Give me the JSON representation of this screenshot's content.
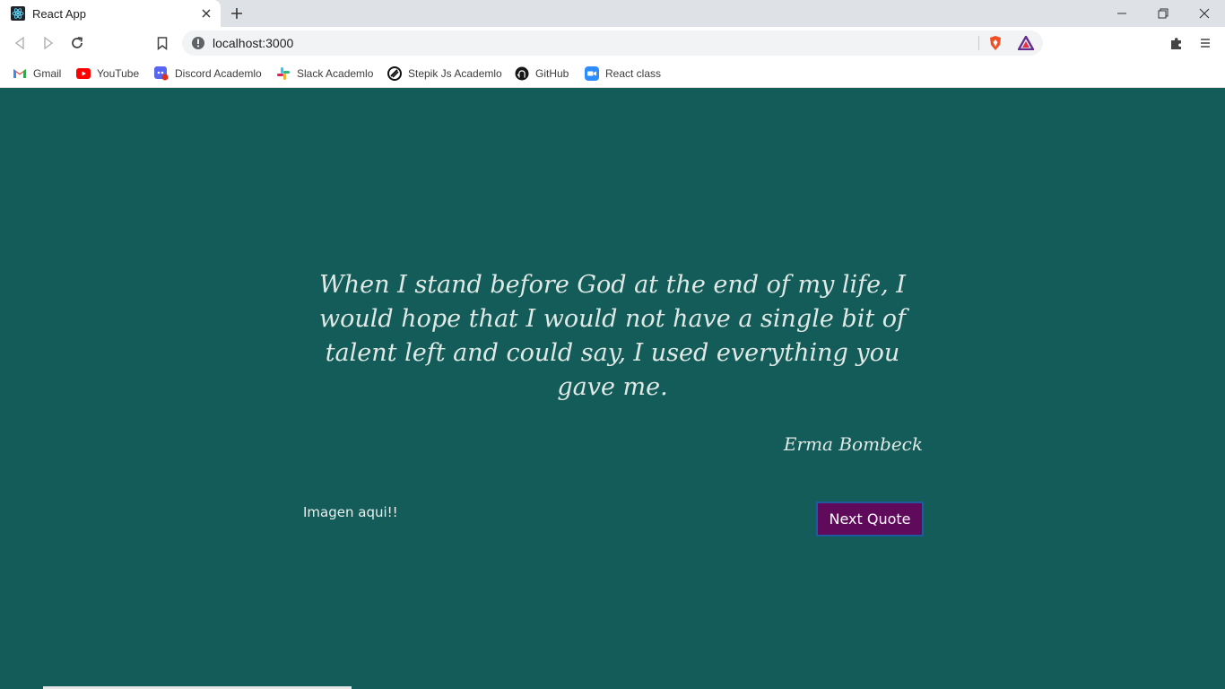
{
  "browser": {
    "tab": {
      "title": "React App",
      "favicon": "react-icon"
    },
    "address": {
      "url": "localhost:3000"
    },
    "bookmarks": [
      {
        "label": "Gmail",
        "icon": "gmail-icon"
      },
      {
        "label": "YouTube",
        "icon": "youtube-icon"
      },
      {
        "label": "Discord Academlo",
        "icon": "discord-icon"
      },
      {
        "label": "Slack Academlo",
        "icon": "slack-icon"
      },
      {
        "label": "Stepik Js Academlo",
        "icon": "stepik-icon"
      },
      {
        "label": "GitHub",
        "icon": "github-icon"
      },
      {
        "label": "React class",
        "icon": "zoom-icon"
      }
    ]
  },
  "app": {
    "quote": "When I stand before God at the end of my life, I would hope that I would not have a single bit of talent left and could say, I used everything you gave me.",
    "author": "Erma Bombeck",
    "image_placeholder": "Imagen aqui!!",
    "next_button": "Next Quote",
    "colors": {
      "background": "#145c59",
      "button": "#600a5c",
      "text": "#dfe9e5"
    }
  }
}
